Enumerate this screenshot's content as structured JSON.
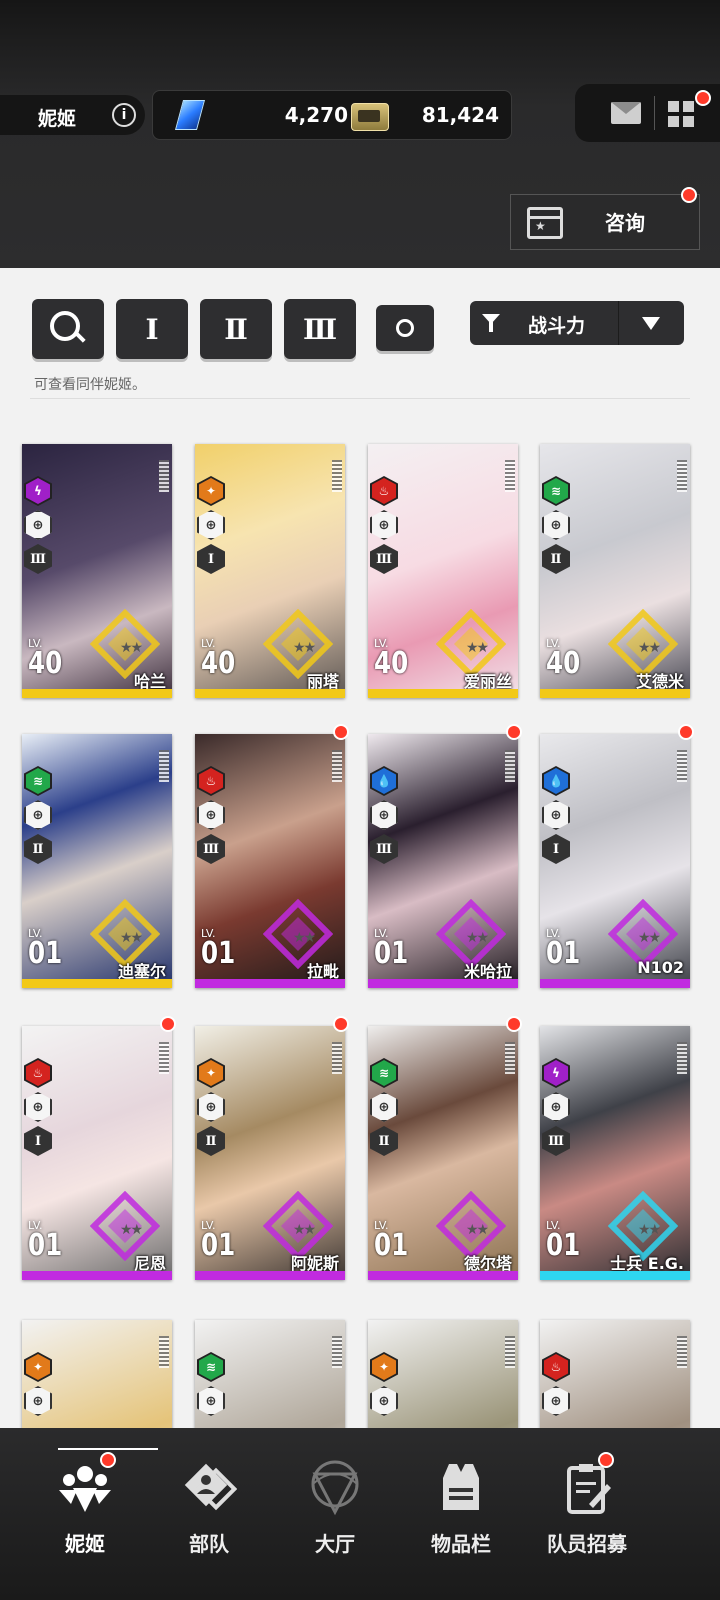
{
  "header": {
    "tab_label": "妮姬",
    "info_glyph": "i",
    "gems": "4,270",
    "plus": "+",
    "credits": "81,424",
    "consult_label": "咨询"
  },
  "filters": {
    "buttons": [
      {
        "key": "search",
        "label": ""
      },
      {
        "key": "burst1",
        "label": "Ⅰ"
      },
      {
        "key": "burst2",
        "label": "Ⅱ"
      },
      {
        "key": "burst3",
        "label": "Ⅲ"
      },
      {
        "key": "all",
        "label": ""
      }
    ],
    "sort_label": "战斗力",
    "hint": "可查看同伴妮姬。"
  },
  "cards": [
    {
      "name": "哈兰",
      "level": "40",
      "lv": "LV.",
      "element": "electric",
      "burst": "Ⅲ",
      "rarity": "gold",
      "new": false
    },
    {
      "name": "丽塔",
      "level": "40",
      "lv": "LV.",
      "element": "iron",
      "burst": "Ⅰ",
      "rarity": "gold",
      "new": false
    },
    {
      "name": "爱丽丝",
      "level": "40",
      "lv": "LV.",
      "element": "fire",
      "burst": "Ⅲ",
      "rarity": "gold",
      "new": false
    },
    {
      "name": "艾德米",
      "level": "40",
      "lv": "LV.",
      "element": "wind",
      "burst": "Ⅱ",
      "rarity": "gold",
      "new": false
    },
    {
      "name": "迪塞尔",
      "level": "01",
      "lv": "LV.",
      "element": "wind",
      "burst": "Ⅱ",
      "rarity": "gold",
      "new": false
    },
    {
      "name": "拉毗",
      "level": "01",
      "lv": "LV.",
      "element": "fire",
      "burst": "Ⅲ",
      "rarity": "purple",
      "new": true
    },
    {
      "name": "米哈拉",
      "level": "01",
      "lv": "LV.",
      "element": "water",
      "burst": "Ⅲ",
      "rarity": "purple",
      "new": true
    },
    {
      "name": "N102",
      "level": "01",
      "lv": "LV.",
      "element": "water",
      "burst": "Ⅰ",
      "rarity": "purple",
      "new": true
    },
    {
      "name": "尼恩",
      "level": "01",
      "lv": "LV.",
      "element": "fire",
      "burst": "Ⅰ",
      "rarity": "purple",
      "new": true
    },
    {
      "name": "阿妮斯",
      "level": "01",
      "lv": "LV.",
      "element": "iron",
      "burst": "Ⅱ",
      "rarity": "purple",
      "new": true
    },
    {
      "name": "德尔塔",
      "level": "01",
      "lv": "LV.",
      "element": "wind",
      "burst": "Ⅱ",
      "rarity": "purple",
      "new": true
    },
    {
      "name": "士兵 E.G.",
      "level": "01",
      "lv": "LV.",
      "element": "electric",
      "burst": "Ⅲ",
      "rarity": "blue",
      "new": false
    },
    {
      "name": "",
      "level": "",
      "lv": "",
      "element": "iron",
      "burst": "",
      "rarity": "gold",
      "new": false
    },
    {
      "name": "",
      "level": "",
      "lv": "",
      "element": "wind",
      "burst": "",
      "rarity": "gold",
      "new": false
    },
    {
      "name": "",
      "level": "",
      "lv": "",
      "element": "iron",
      "burst": "",
      "rarity": "gold",
      "new": false
    },
    {
      "name": "",
      "level": "",
      "lv": "",
      "element": "fire",
      "burst": "",
      "rarity": "gold",
      "new": false
    }
  ],
  "nav": [
    {
      "label": "妮姬",
      "icon": "nikke-people-icon",
      "active": true,
      "new": true
    },
    {
      "label": "部队",
      "icon": "squad-icon",
      "active": false,
      "new": false
    },
    {
      "label": "大厅",
      "icon": "lobby-dome-icon",
      "active": false,
      "new": false
    },
    {
      "label": "物品栏",
      "icon": "inventory-vest-icon",
      "active": false,
      "new": false
    },
    {
      "label": "队员招募",
      "icon": "recruit-clipboard-icon",
      "active": false,
      "new": true
    }
  ],
  "colors": {
    "electric": "#a020c8",
    "iron": "#e27a1a",
    "fire": "#d4231f",
    "wind": "#22a84a",
    "water": "#1f6fd8",
    "gold": "#f2c918",
    "purple": "#c12ae0",
    "blue": "#2ed6f0"
  }
}
